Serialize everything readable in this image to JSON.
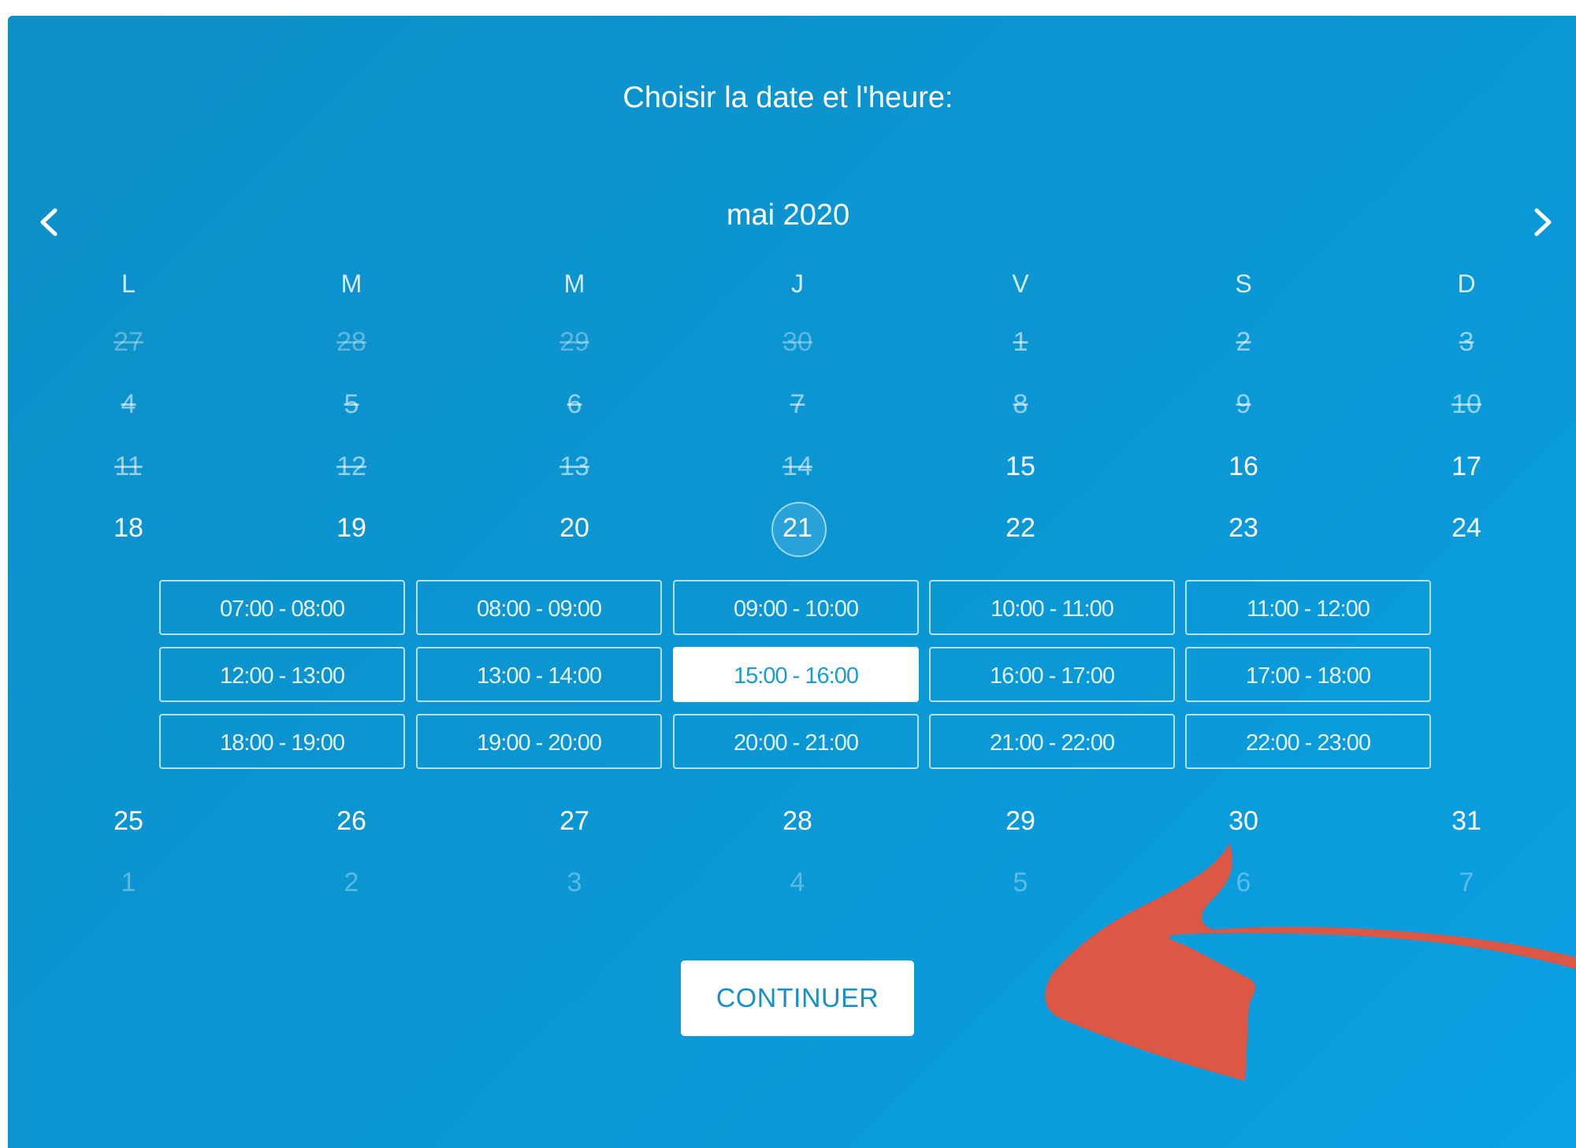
{
  "header": {
    "title": "Choisir la date et l'heure:"
  },
  "calendar": {
    "month_label": "mai 2020",
    "prev_icon": "chevron-left-icon",
    "next_icon": "chevron-right-icon",
    "weekdays": [
      "L",
      "M",
      "M",
      "J",
      "V",
      "S",
      "D"
    ],
    "weeks": [
      [
        {
          "d": "27",
          "s": "muted-struck"
        },
        {
          "d": "28",
          "s": "muted-struck"
        },
        {
          "d": "29",
          "s": "muted-struck"
        },
        {
          "d": "30",
          "s": "muted-struck"
        },
        {
          "d": "1",
          "s": "dim-struck"
        },
        {
          "d": "2",
          "s": "dim-struck"
        },
        {
          "d": "3",
          "s": "dim-struck"
        }
      ],
      [
        {
          "d": "4",
          "s": "dim-struck"
        },
        {
          "d": "5",
          "s": "dim-struck"
        },
        {
          "d": "6",
          "s": "dim-struck"
        },
        {
          "d": "7",
          "s": "dim-struck"
        },
        {
          "d": "8",
          "s": "dim-struck"
        },
        {
          "d": "9",
          "s": "dim-struck"
        },
        {
          "d": "10",
          "s": "dim-struck"
        }
      ],
      [
        {
          "d": "11",
          "s": "dim-struck"
        },
        {
          "d": "12",
          "s": "dim-struck"
        },
        {
          "d": "13",
          "s": "dim-struck"
        },
        {
          "d": "14",
          "s": "dim-struck"
        },
        {
          "d": "15",
          "s": "available"
        },
        {
          "d": "16",
          "s": "available"
        },
        {
          "d": "17",
          "s": "available"
        }
      ],
      [
        {
          "d": "18",
          "s": "available"
        },
        {
          "d": "19",
          "s": "available"
        },
        {
          "d": "20",
          "s": "available"
        },
        {
          "d": "21",
          "s": "selected"
        },
        {
          "d": "22",
          "s": "available"
        },
        {
          "d": "23",
          "s": "available"
        },
        {
          "d": "24",
          "s": "available"
        }
      ],
      [
        {
          "d": "25",
          "s": "available"
        },
        {
          "d": "26",
          "s": "available"
        },
        {
          "d": "27",
          "s": "available"
        },
        {
          "d": "28",
          "s": "available"
        },
        {
          "d": "29",
          "s": "available"
        },
        {
          "d": "30",
          "s": "available"
        },
        {
          "d": "31",
          "s": "available"
        }
      ],
      [
        {
          "d": "1",
          "s": "muted"
        },
        {
          "d": "2",
          "s": "muted"
        },
        {
          "d": "3",
          "s": "muted"
        },
        {
          "d": "4",
          "s": "muted"
        },
        {
          "d": "5",
          "s": "muted"
        },
        {
          "d": "6",
          "s": "muted"
        },
        {
          "d": "7",
          "s": "muted"
        }
      ]
    ],
    "selected_day": "21"
  },
  "time_slots": [
    [
      "07:00 - 08:00",
      "08:00 - 09:00",
      "09:00 - 10:00",
      "10:00 - 11:00",
      "11:00 - 12:00"
    ],
    [
      "12:00 - 13:00",
      "13:00 - 14:00",
      "15:00 - 16:00",
      "16:00 - 17:00",
      "17:00 - 18:00"
    ],
    [
      "18:00 - 19:00",
      "19:00 - 20:00",
      "20:00 - 21:00",
      "21:00 - 22:00",
      "22:00 - 23:00"
    ]
  ],
  "selected_slot": "15:00 - 16:00",
  "actions": {
    "continue_label": "CONTINUER"
  },
  "annotation": {
    "icon": "curved-arrow-icon",
    "color": "#dd5745"
  },
  "colors": {
    "panel": "#0a98d6",
    "accent_text": "#1a8ec6"
  }
}
